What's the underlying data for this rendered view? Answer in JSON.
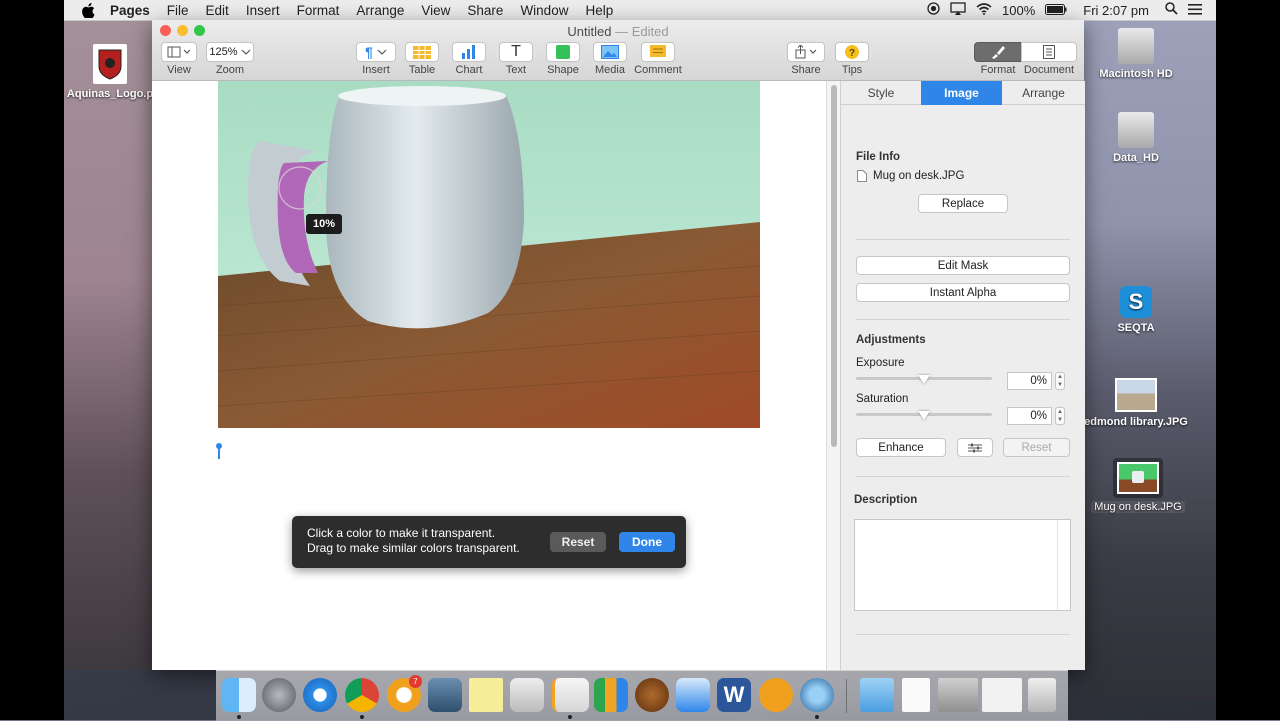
{
  "menubar": {
    "app_name": "Pages",
    "items": [
      "File",
      "Edit",
      "Insert",
      "Format",
      "Arrange",
      "View",
      "Share",
      "Window",
      "Help"
    ],
    "battery": "100%",
    "clock": "Fri 2:07 pm"
  },
  "desktop": {
    "left_icon": "Aquinas_Logo.p",
    "right_icons": [
      "Macintosh HD",
      "Data_HD",
      "SEQTA",
      "edmond library.JPG",
      "Mug on desk.JPG"
    ]
  },
  "window": {
    "title": "Untitled",
    "title_sep": "—",
    "title_status": "Edited",
    "toolbar": {
      "view": "View",
      "zoom_value": "125%",
      "zoom": "Zoom",
      "insert": "Insert",
      "table": "Table",
      "chart": "Chart",
      "text": "Text",
      "shape": "Shape",
      "media": "Media",
      "comment": "Comment",
      "share": "Share",
      "tips": "Tips",
      "format": "Format",
      "document": "Document"
    }
  },
  "canvas": {
    "tolerance_label": "10%"
  },
  "hud": {
    "line1": "Click a color to make it transparent.",
    "line2": "Drag to make similar colors transparent.",
    "reset": "Reset",
    "done": "Done"
  },
  "inspector": {
    "tabs": [
      "Style",
      "Image",
      "Arrange"
    ],
    "active_tab": "Image",
    "file_info_heading": "File Info",
    "file_name": "Mug on desk.JPG",
    "replace": "Replace",
    "edit_mask": "Edit Mask",
    "instant_alpha": "Instant Alpha",
    "adjustments_heading": "Adjustments",
    "exposure_label": "Exposure",
    "exposure_value": "0%",
    "exposure_level": 0.5,
    "saturation_label": "Saturation",
    "saturation_value": "0%",
    "saturation_level": 0.5,
    "enhance": "Enhance",
    "reset": "Reset",
    "description_heading": "Description"
  },
  "colors": {
    "accent": "#2f86e8",
    "close": "#fc5f57",
    "minimize": "#fdbc2e",
    "zoom": "#33c748"
  }
}
